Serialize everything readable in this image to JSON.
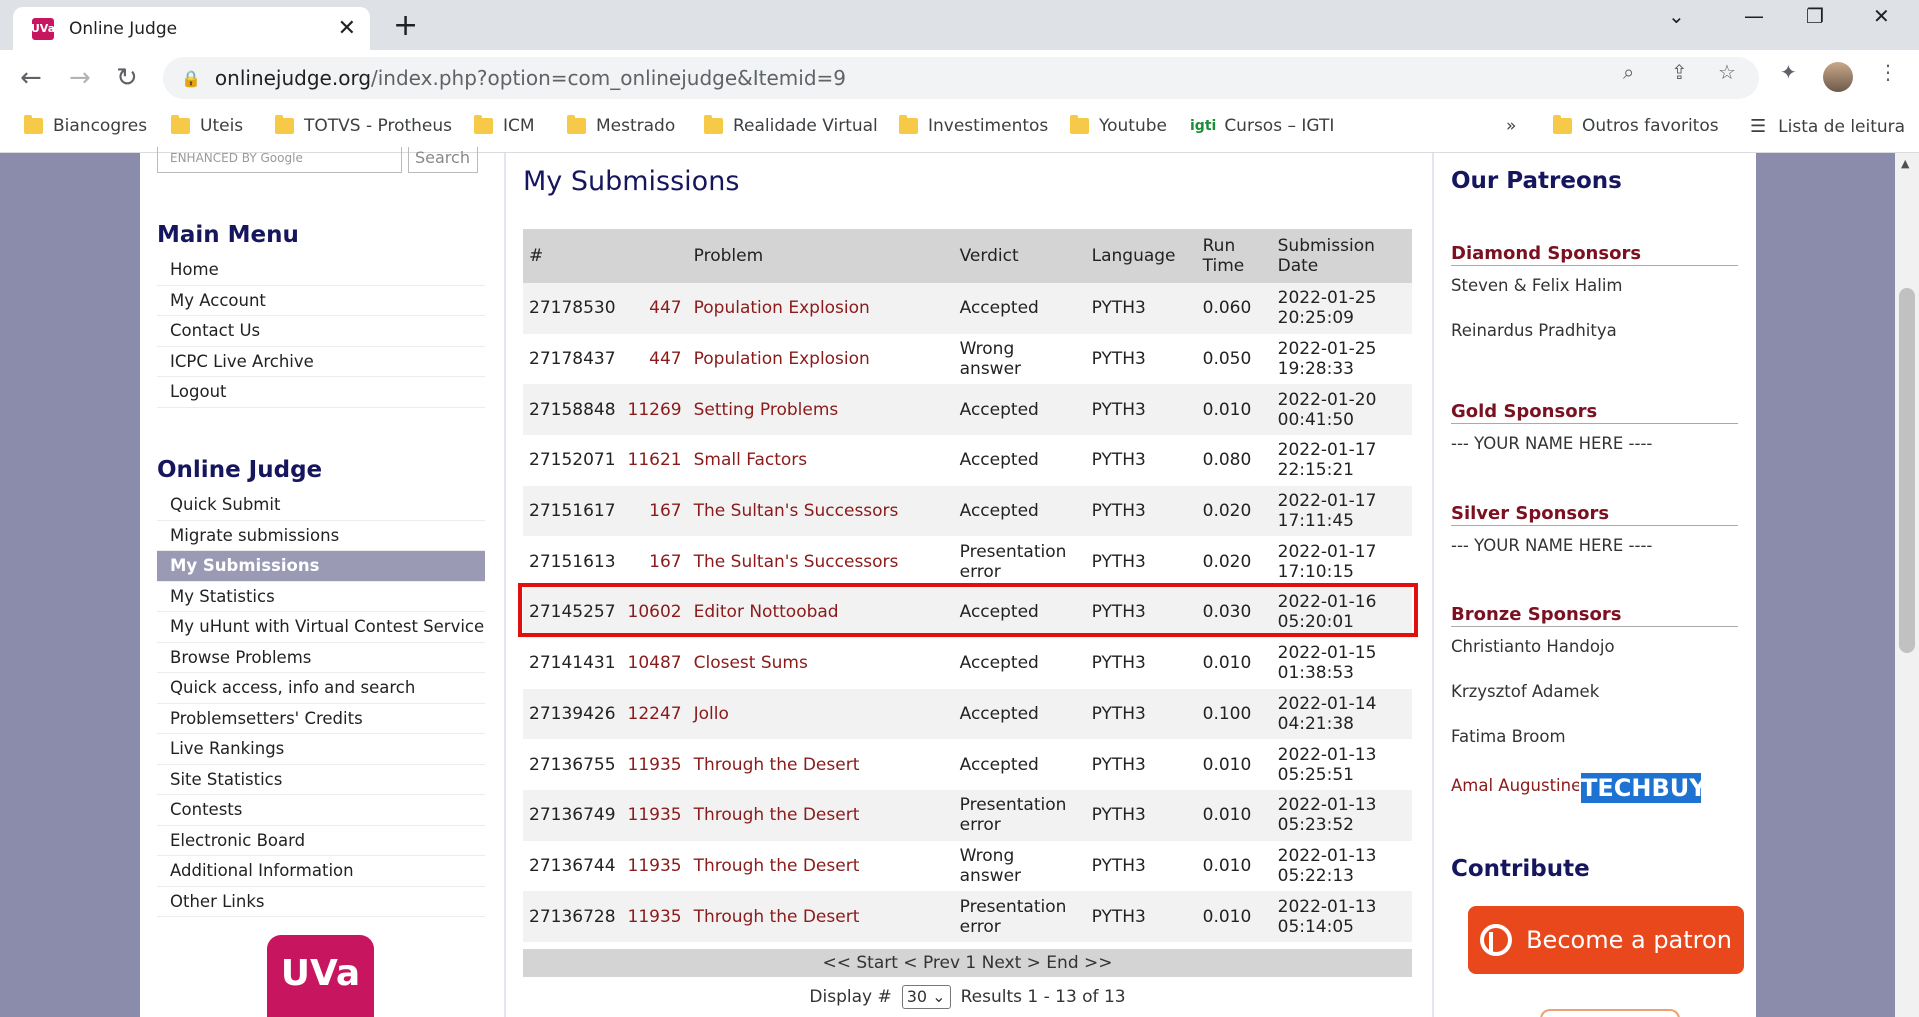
{
  "browser": {
    "tab_title": "Online Judge",
    "favicon_text": "UVa",
    "url_host": "onlinejudge.org",
    "url_path": "/index.php?option=com_onlinejudge&Itemid=9",
    "bookmarks": [
      "Biancogres",
      "Uteis",
      "TOTVS - Protheus",
      "ICM",
      "Mestrado",
      "Realidade Virtual",
      "Investimentos",
      "Youtube",
      "Cursos – IGTI"
    ],
    "other_favorites": "Outros favoritos",
    "reading_list": "Lista de leitura",
    "more_bookmarks": "»"
  },
  "left": {
    "search_placeholder": "ENHANCED BY Google",
    "search_button": "Search",
    "main_menu_title": "Main Menu",
    "main_menu": [
      "Home",
      "My Account",
      "Contact Us",
      "ICPC Live Archive",
      "Logout"
    ],
    "oj_title": "Online Judge",
    "oj_menu": [
      "Quick Submit",
      "Migrate submissions",
      "My Submissions",
      "My Statistics",
      "My uHunt with Virtual Contest Service",
      "Browse Problems",
      "Quick access, info and search",
      "Problemsetters' Credits",
      "Live Rankings",
      "Site Statistics",
      "Contests",
      "Electronic Board",
      "Additional Information",
      "Other Links"
    ],
    "logo_text": "UVa"
  },
  "main": {
    "title": "My Submissions",
    "headers": {
      "id": "#",
      "problem": "Problem",
      "verdict": "Verdict",
      "language": "Language",
      "run_time": "Run Time",
      "date": "Submission Date"
    },
    "rows": [
      {
        "id": "27178530",
        "pid": "447",
        "pname": "Population Explosion",
        "verdict": "Accepted",
        "lang": "PYTH3",
        "time": "0.060",
        "date": "2022-01-25",
        "clock": "20:25:09"
      },
      {
        "id": "27178437",
        "pid": "447",
        "pname": "Population Explosion",
        "verdict": "Wrong answer",
        "lang": "PYTH3",
        "time": "0.050",
        "date": "2022-01-25",
        "clock": "19:28:33"
      },
      {
        "id": "27158848",
        "pid": "11269",
        "pname": "Setting Problems",
        "verdict": "Accepted",
        "lang": "PYTH3",
        "time": "0.010",
        "date": "2022-01-20",
        "clock": "00:41:50"
      },
      {
        "id": "27152071",
        "pid": "11621",
        "pname": "Small Factors",
        "verdict": "Accepted",
        "lang": "PYTH3",
        "time": "0.080",
        "date": "2022-01-17",
        "clock": "22:15:21"
      },
      {
        "id": "27151617",
        "pid": "167",
        "pname": "The Sultan's Successors",
        "verdict": "Accepted",
        "lang": "PYTH3",
        "time": "0.020",
        "date": "2022-01-17",
        "clock": "17:11:45"
      },
      {
        "id": "27151613",
        "pid": "167",
        "pname": "The Sultan's Successors",
        "verdict": "Presentation error",
        "lang": "PYTH3",
        "time": "0.020",
        "date": "2022-01-17",
        "clock": "17:10:15"
      },
      {
        "id": "27145257",
        "pid": "10602",
        "pname": "Editor Nottoobad",
        "verdict": "Accepted",
        "lang": "PYTH3",
        "time": "0.030",
        "date": "2022-01-16",
        "clock": "05:20:01"
      },
      {
        "id": "27141431",
        "pid": "10487",
        "pname": "Closest Sums",
        "verdict": "Accepted",
        "lang": "PYTH3",
        "time": "0.010",
        "date": "2022-01-15",
        "clock": "01:38:53"
      },
      {
        "id": "27139426",
        "pid": "12247",
        "pname": "Jollo",
        "verdict": "Accepted",
        "lang": "PYTH3",
        "time": "0.100",
        "date": "2022-01-14",
        "clock": "04:21:38"
      },
      {
        "id": "27136755",
        "pid": "11935",
        "pname": "Through the Desert",
        "verdict": "Accepted",
        "lang": "PYTH3",
        "time": "0.010",
        "date": "2022-01-13",
        "clock": "05:25:51"
      },
      {
        "id": "27136749",
        "pid": "11935",
        "pname": "Through the Desert",
        "verdict": "Presentation error",
        "lang": "PYTH3",
        "time": "0.010",
        "date": "2022-01-13",
        "clock": "05:23:52"
      },
      {
        "id": "27136744",
        "pid": "11935",
        "pname": "Through the Desert",
        "verdict": "Wrong answer",
        "lang": "PYTH3",
        "time": "0.010",
        "date": "2022-01-13",
        "clock": "05:22:13"
      },
      {
        "id": "27136728",
        "pid": "11935",
        "pname": "Through the Desert",
        "verdict": "Presentation error",
        "lang": "PYTH3",
        "time": "0.010",
        "date": "2022-01-13",
        "clock": "05:14:05"
      }
    ],
    "pager": "<< Start < Prev 1 Next > End >>",
    "display_label": "Display #",
    "display_value": "30",
    "results": "Results 1 - 13 of 13"
  },
  "right": {
    "patreons_title": "Our Patreons",
    "diamond_head": "Diamond Sponsors",
    "diamond": [
      "Steven & Felix Halim",
      "Reinardus Pradhitya"
    ],
    "gold_head": "Gold Sponsors",
    "gold": "--- YOUR NAME HERE ----",
    "silver_head": "Silver Sponsors",
    "silver": "--- YOUR NAME HERE ----",
    "bronze_head": "Bronze Sponsors",
    "bronze": [
      "Christianto Handojo",
      "Krzysztof Adamek",
      "Fatima Broom"
    ],
    "bronze_link": "Amal Augustine",
    "techbuy": "TECHBUY",
    "contribute_title": "Contribute",
    "patron_button": "Become a patron"
  },
  "colors": {
    "accent": "#16165e",
    "link": "#8b1a1a",
    "highlight": "#e01010",
    "patron": "#e8481c"
  }
}
